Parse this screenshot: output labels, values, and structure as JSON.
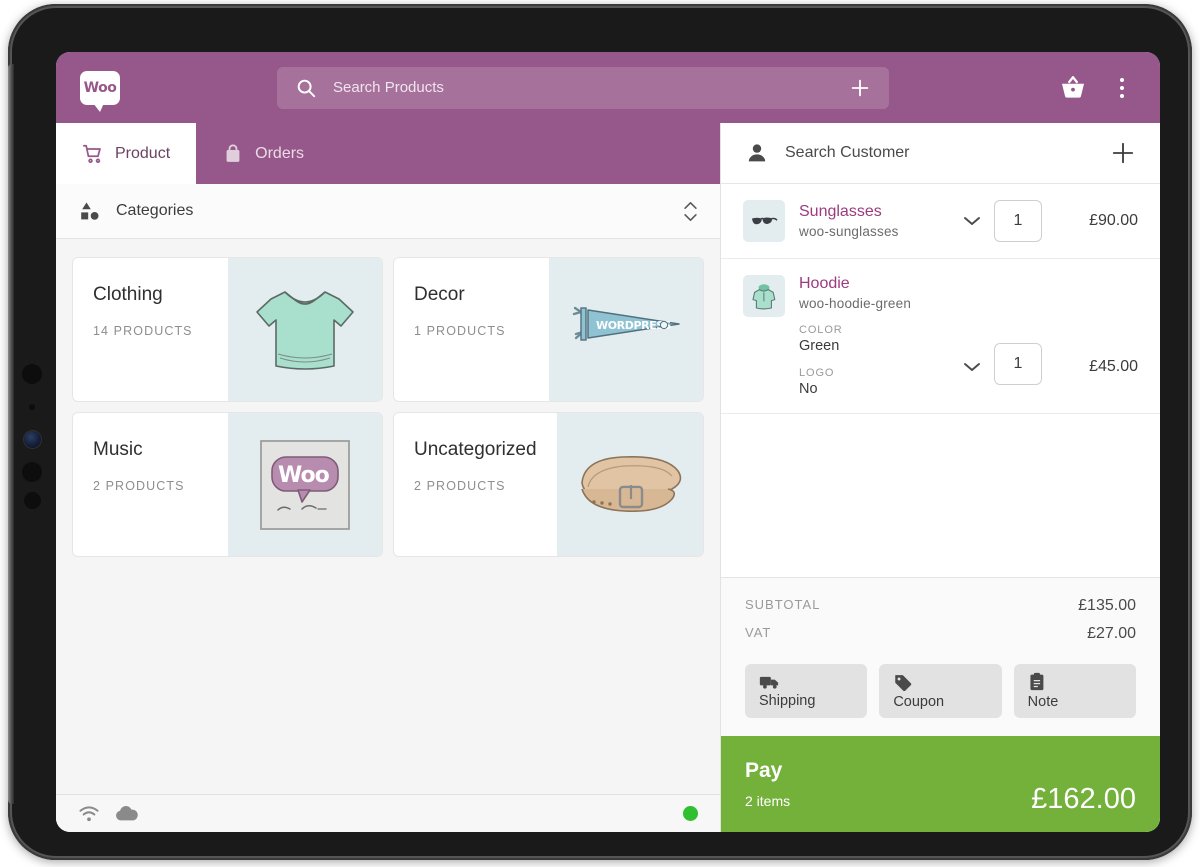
{
  "header": {
    "logo_text": "Woo",
    "search_placeholder": "Search Products",
    "search_value": "",
    "cart_icon": "basket-icon",
    "menu_icon": "more-vertical-icon",
    "add_icon": "plus-icon"
  },
  "tabs": [
    {
      "label": "Product",
      "icon": "shopping-cart-icon",
      "active": true
    },
    {
      "label": "Orders",
      "icon": "bag-icon",
      "active": false
    }
  ],
  "categories_bar": {
    "title": "Categories",
    "icon": "shapes-icon",
    "sort_icon": "sort-updown-icon"
  },
  "categories": [
    {
      "name": "Clothing",
      "count": "14 PRODUCTS",
      "thumb": "tshirt-illustration"
    },
    {
      "name": "Decor",
      "count": "1 PRODUCTS",
      "thumb": "wordpress-pennant-illustration"
    },
    {
      "name": "Music",
      "count": "2 PRODUCTS",
      "thumb": "woo-single-album-illustration"
    },
    {
      "name": "Uncategorized",
      "count": "2 PRODUCTS",
      "thumb": "leather-belt-illustration"
    }
  ],
  "statusbar": {
    "wifi_icon": "wifi-icon",
    "cloud_icon": "cloud-icon",
    "online_indicator": "online-status-dot",
    "online_color": "#2fbf2f"
  },
  "cart": {
    "customer_placeholder": "Search Customer",
    "customer_value": "",
    "customer_icon": "person-icon",
    "add_customer_icon": "plus-icon",
    "items": [
      {
        "name": "Sunglasses",
        "sku": "woo-sunglasses",
        "thumb": "sunglasses-thumbnail",
        "quantity": "1",
        "price": "£90.00",
        "variations": []
      },
      {
        "name": "Hoodie",
        "sku": "woo-hoodie-green",
        "thumb": "hoodie-thumbnail",
        "quantity": "1",
        "price": "£45.00",
        "variations": [
          {
            "label": "COLOR",
            "value": "Green"
          },
          {
            "label": "LOGO",
            "value": "No"
          }
        ]
      }
    ],
    "totals": [
      {
        "label": "SUBTOTAL",
        "value": "£135.00"
      },
      {
        "label": "VAT",
        "value": "£27.00"
      }
    ],
    "actions": [
      {
        "label": "Shipping",
        "icon": "truck-icon"
      },
      {
        "label": "Coupon",
        "icon": "tag-icon"
      },
      {
        "label": "Note",
        "icon": "clipboard-icon"
      }
    ],
    "pay": {
      "label": "Pay",
      "items_text": "2 items",
      "total": "£162.00",
      "color": "#74b13a"
    }
  },
  "colors": {
    "brand_purple": "#96588a",
    "accent_magenta": "#9b3b7f",
    "pay_green": "#74b13a",
    "thumb_bg": "#e3edf0"
  }
}
